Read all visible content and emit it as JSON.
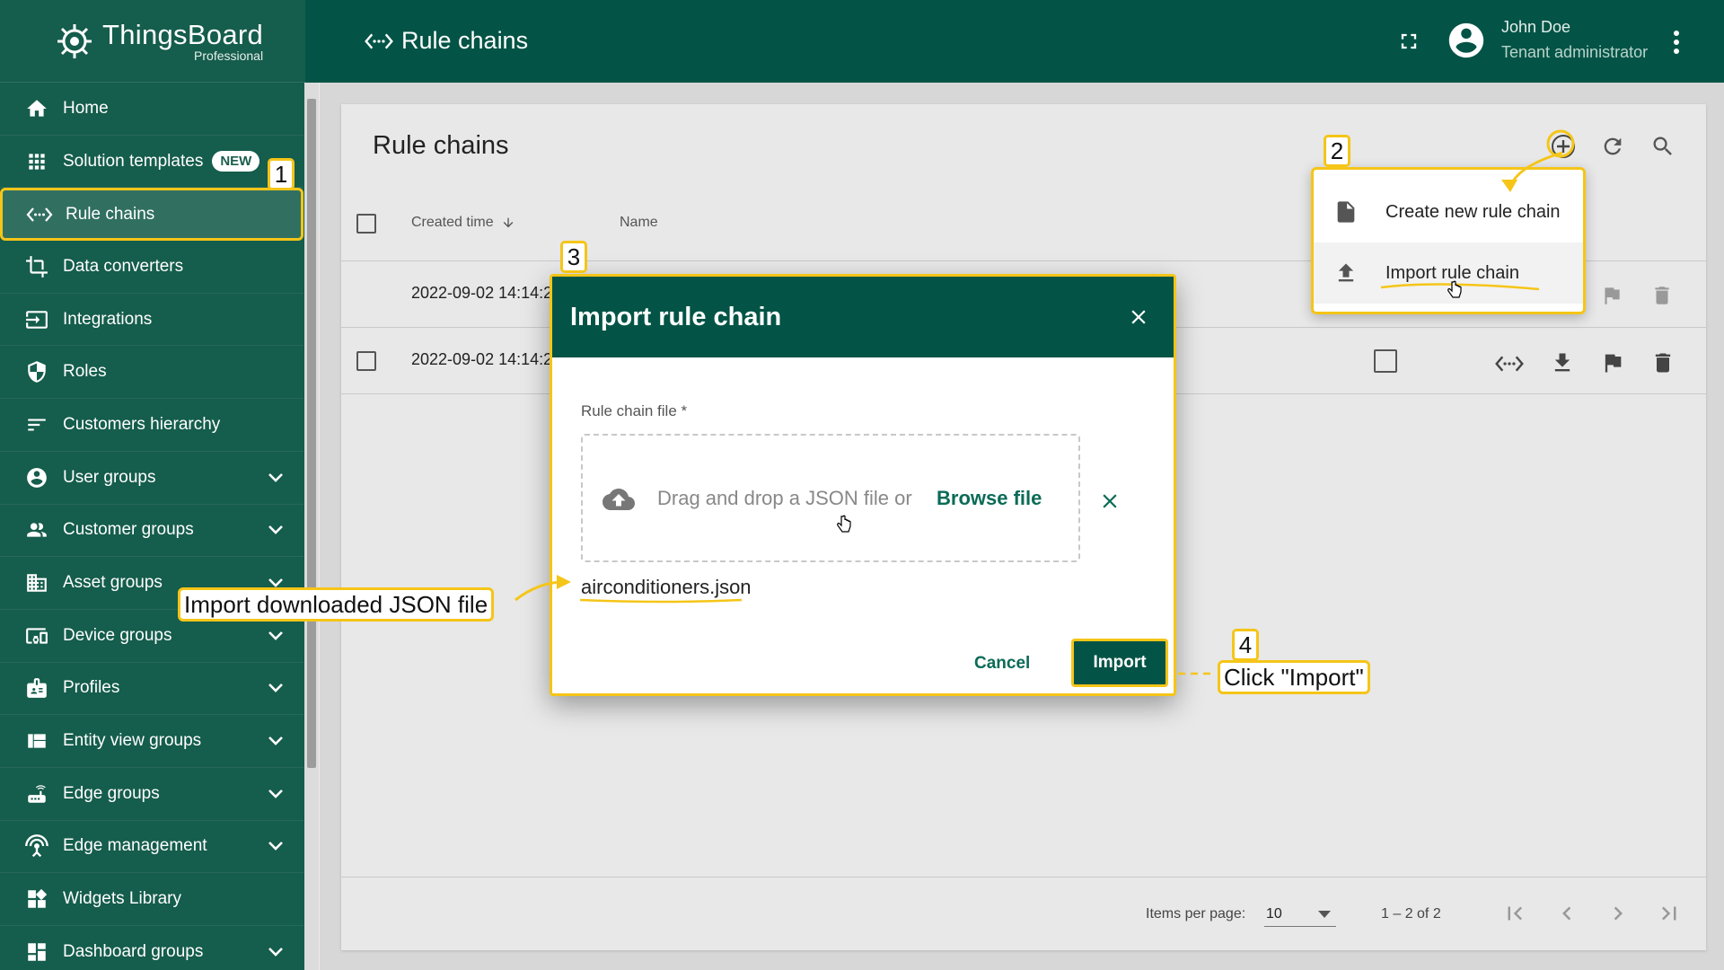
{
  "app": {
    "logo_name": "ThingsBoard",
    "logo_sub": "Professional"
  },
  "sidebar": {
    "items": [
      {
        "label": "Home",
        "icon": "home-icon"
      },
      {
        "label": "Solution templates",
        "icon": "apps-grid-icon",
        "badge": "NEW"
      },
      {
        "label": "Rule chains",
        "icon": "code-arrows-icon",
        "active": true
      },
      {
        "label": "Data converters",
        "icon": "crop-icon"
      },
      {
        "label": "Integrations",
        "icon": "input-icon"
      },
      {
        "label": "Roles",
        "icon": "shield-icon"
      },
      {
        "label": "Customers hierarchy",
        "icon": "sort-lines-icon"
      },
      {
        "label": "User groups",
        "icon": "account-circle-icon",
        "expandable": true
      },
      {
        "label": "Customer groups",
        "icon": "people-icon",
        "expandable": true
      },
      {
        "label": "Asset groups",
        "icon": "domain-icon",
        "expandable": true
      },
      {
        "label": "Device groups",
        "icon": "devices-icon",
        "expandable": true
      },
      {
        "label": "Profiles",
        "icon": "badge-icon",
        "expandable": true
      },
      {
        "label": "Entity view groups",
        "icon": "view-quilt-icon",
        "expandable": true
      },
      {
        "label": "Edge groups",
        "icon": "router-icon",
        "expandable": true
      },
      {
        "label": "Edge management",
        "icon": "settings-input-antenna-icon",
        "expandable": true
      },
      {
        "label": "Widgets Library",
        "icon": "widgets-icon"
      },
      {
        "label": "Dashboard groups",
        "icon": "dashboard-icon",
        "expandable": true
      }
    ]
  },
  "topbar": {
    "title": "Rule chains",
    "user_name": "John Doe",
    "user_role": "Tenant administrator"
  },
  "card": {
    "title": "Rule chains",
    "columns": {
      "created_time": "Created time",
      "name": "Name"
    },
    "rows": [
      {
        "created": "2022-09-02 14:14:2"
      },
      {
        "created": "2022-09-02 14:14:2"
      }
    ],
    "pager": {
      "items_per_page_label": "Items per page:",
      "items_per_page_value": "10",
      "range": "1 – 2 of 2"
    }
  },
  "add_menu": {
    "create_label": "Create new rule chain",
    "import_label": "Import rule chain"
  },
  "dialog": {
    "title": "Import rule chain",
    "field_label": "Rule chain file *",
    "drop_text": "Drag and drop a JSON file or",
    "browse_label": "Browse file",
    "file_name": "airconditioners.json",
    "cancel_label": "Cancel",
    "import_label": "Import"
  },
  "annotations": {
    "step1": "1",
    "step2": "2",
    "step3": "3",
    "step4": "4",
    "import_file_note": "Import downloaded JSON file",
    "click_import_note": "Click \"Import\""
  },
  "colors": {
    "primary": "#035446",
    "sidebar": "#155d4c",
    "highlight": "#f5c518"
  }
}
